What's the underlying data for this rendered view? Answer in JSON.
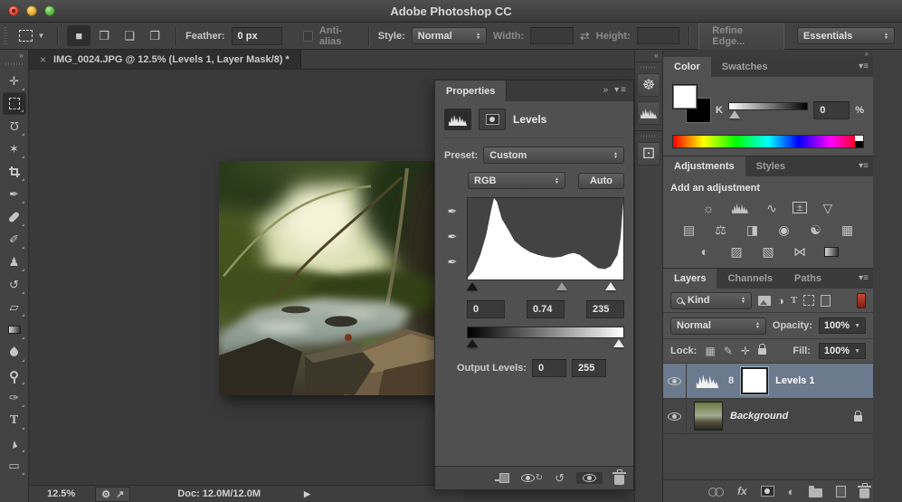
{
  "window": {
    "title": "Adobe Photoshop CC"
  },
  "options_bar": {
    "feather_label": "Feather:",
    "feather_value": "0 px",
    "antialias_label": "Anti-alias",
    "style_label": "Style:",
    "style_value": "Normal",
    "width_label": "Width:",
    "width_value": "",
    "height_label": "Height:",
    "height_value": "",
    "refine_edge_label": "Refine Edge...",
    "workspace_value": "Essentials",
    "selection_modes": [
      "new-selection",
      "add-to-selection",
      "subtract-from-selection",
      "intersect-selection"
    ]
  },
  "document_tab": {
    "close_label": "×",
    "label": "IMG_0024.JPG @ 12.5% (Levels 1, Layer Mask/8) *"
  },
  "toolbar": {
    "selected_tool": "rectangular-marquee",
    "tools": [
      "move",
      "rectangular-marquee",
      "lasso",
      "magic-wand",
      "crop",
      "eyedropper",
      "spot-healing-brush",
      "brush",
      "clone-stamp",
      "history-brush",
      "eraser",
      "gradient",
      "blur",
      "dodge",
      "pen",
      "horizontal-type",
      "path-selection",
      "rectangle-shape"
    ]
  },
  "properties": {
    "tab_label": "Properties",
    "adjustment_title": "Levels",
    "preset_label": "Preset:",
    "preset_value": "Custom",
    "channel_value": "RGB",
    "auto_label": "Auto",
    "input_shadow": "0",
    "input_midtone": "0.74",
    "input_highlight": "235",
    "output_label": "Output Levels:",
    "output_shadow": "0",
    "output_highlight": "255",
    "histogram_channel": "RGB"
  },
  "collapsed_dock": {
    "panels": [
      "navigator",
      "histogram",
      "3d"
    ]
  },
  "color_panel": {
    "tabs": {
      "color": "Color",
      "swatches": "Swatches"
    },
    "k_label": "K",
    "k_value": "0",
    "unit_label": "%"
  },
  "adjustments_panel": {
    "tabs": {
      "adjustments": "Adjustments",
      "styles": "Styles"
    },
    "heading": "Add an adjustment",
    "icons": [
      "brightness-contrast",
      "levels",
      "curves",
      "exposure",
      "vibrance",
      "hue-saturation",
      "color-balance",
      "black-white",
      "photo-filter",
      "channel-mixer",
      "color-lookup",
      "invert",
      "posterize",
      "threshold",
      "gradient-map",
      "selective-color"
    ]
  },
  "layers_panel": {
    "tabs": {
      "layers": "Layers",
      "channels": "Channels",
      "paths": "Paths"
    },
    "kind_value": "Kind",
    "blend_mode_value": "Normal",
    "opacity_label": "Opacity:",
    "opacity_value": "100%",
    "lock_label": "Lock:",
    "fill_label": "Fill:",
    "fill_value": "100%",
    "layers": [
      {
        "name": "Levels 1",
        "selected": true,
        "type": "levels-adjustment"
      },
      {
        "name": "Background",
        "selected": false,
        "type": "image",
        "locked": true
      }
    ]
  },
  "status_bar": {
    "zoom_value": "12.5%",
    "doc_label": "Doc: 12.0M/12.0M"
  },
  "colors": {
    "selected_layer_highlight": "#6b7a8c",
    "panel_background": "#515151",
    "canvas_background": "#393939",
    "layer_filter_switch": "#b8392a"
  }
}
